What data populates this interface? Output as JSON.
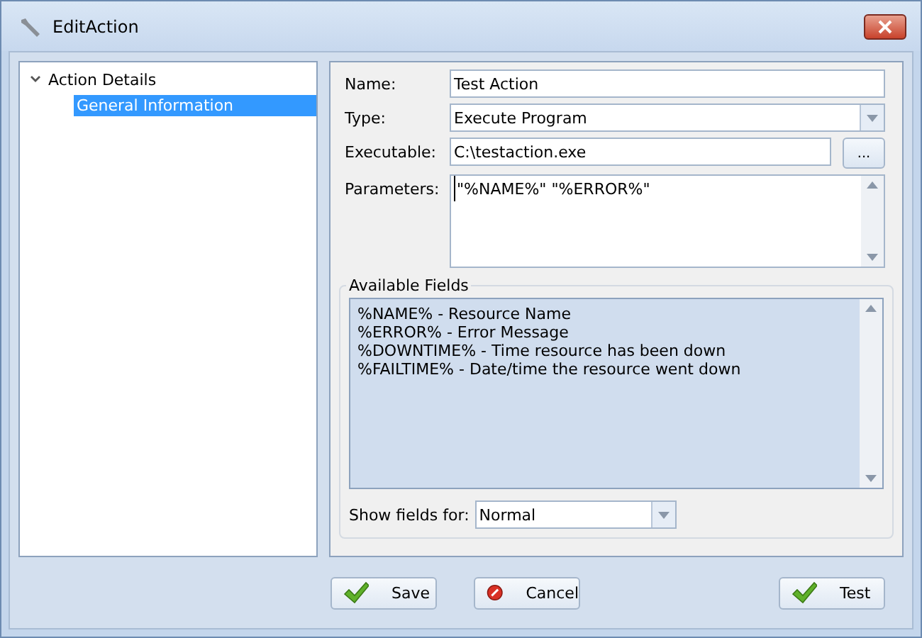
{
  "window": {
    "title": "EditAction"
  },
  "tree": [
    {
      "label": "Action Details",
      "expanded": true,
      "selected": false,
      "children": [
        {
          "label": "General Information",
          "selected": true
        }
      ]
    }
  ],
  "form": {
    "name": {
      "label": "Name:",
      "value": "Test Action"
    },
    "type": {
      "label": "Type:",
      "value": "Execute Program"
    },
    "executable": {
      "label": "Executable:",
      "value": "C:\\testaction.exe",
      "browse": "..."
    },
    "parameters": {
      "label": "Parameters:",
      "value": "\"%NAME%\" \"%ERROR%\""
    }
  },
  "available_fields": {
    "title": "Available Fields",
    "items": [
      "%NAME% - Resource Name",
      "%ERROR% - Error Message",
      "%DOWNTIME% - Time resource has been down",
      "%FAILTIME% - Date/time the resource went down"
    ],
    "show_for": {
      "label": "Show fields for:",
      "value": "Normal"
    }
  },
  "buttons": [
    {
      "label": "Save",
      "kind": "ok"
    },
    {
      "label": "Cancel",
      "kind": "cancel"
    },
    {
      "label": "Test",
      "kind": "ok"
    }
  ]
}
